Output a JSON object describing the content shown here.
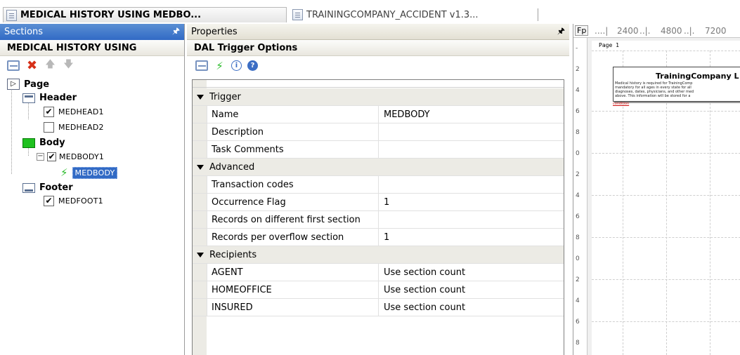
{
  "doc_tabs": [
    {
      "label": "MEDICAL HISTORY USING MEDBO...",
      "active": true
    },
    {
      "label": "TRAININGCOMPANY_ACCIDENT v1.3...",
      "active": false
    }
  ],
  "sections_pane": {
    "title": "Sections",
    "heading": "MEDICAL HISTORY USING",
    "toolbar_icons": [
      "new-section-icon",
      "delete-icon",
      "move-up-icon",
      "move-down-icon"
    ],
    "tree": {
      "page": "Page",
      "header": "Header",
      "medhead1": "MEDHEAD1",
      "medhead2": "MEDHEAD2",
      "body": "Body",
      "medbody1": "MEDBODY1",
      "medbody": "MEDBODY",
      "footer": "Footer",
      "medfoot1": "MEDFOOT1"
    },
    "checked": {
      "medhead1": true,
      "medhead2": false,
      "medbody1": true,
      "medfoot1": true
    }
  },
  "properties_pane": {
    "title": "Properties",
    "heading": "DAL Trigger Options",
    "toolbar_icons": [
      "new-icon",
      "trigger-icon",
      "info-icon",
      "help-icon"
    ],
    "categories": {
      "trigger": "Trigger",
      "advanced": "Advanced",
      "recipients": "Recipients"
    },
    "rows": {
      "name": {
        "key": "Name",
        "value": "MEDBODY"
      },
      "description": {
        "key": "Description",
        "value": ""
      },
      "task_comments": {
        "key": "Task Comments",
        "value": ""
      },
      "transaction_codes": {
        "key": "Transaction codes",
        "value": ""
      },
      "occurrence_flag": {
        "key": "Occurrence Flag",
        "value": "1"
      },
      "records_diff_first": {
        "key": "Records on different first section",
        "value": ""
      },
      "records_per_overflow": {
        "key": "Records per overflow section",
        "value": "1"
      },
      "agent": {
        "key": "AGENT",
        "value": "Use section count"
      },
      "homeoffice": {
        "key": "HOMEOFFICE",
        "value": "Use section count"
      },
      "insured": {
        "key": "INSURED",
        "value": "Use section count"
      }
    }
  },
  "preview_pane": {
    "fp_label": "Fp",
    "ruler_ticks": [
      "2400",
      "4800",
      "7200"
    ],
    "page_label": "Page 1",
    "doc_title": "TrainingCompany L",
    "doc_lines": [
      "Medical history is required for TrainingComp",
      "mandatory for all ages in every state for all",
      "diagnoses, dates, physicians, and other med",
      "above.  This information will be stored for a"
    ],
    "doc_link": "condition"
  },
  "colors": {
    "active_titlebar": "#316ac5",
    "selection": "#316ac5",
    "delete_red": "#d63018",
    "bolt_green": "#2bbb2b"
  }
}
